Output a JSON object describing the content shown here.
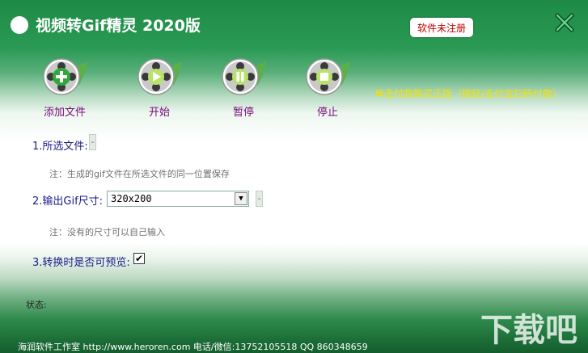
{
  "window": {
    "title": "视频转Gif精灵 2020版",
    "registration_badge": "软件未注册"
  },
  "toolbar": {
    "items": [
      {
        "label": "添加文件",
        "icon": "add-file-icon"
      },
      {
        "label": "开始",
        "icon": "play-icon"
      },
      {
        "label": "暂停",
        "icon": "pause-icon"
      },
      {
        "label": "停止",
        "icon": "stop-icon"
      }
    ]
  },
  "buy_link": "单击付款购买正版（微信/支付宝扫码付款）",
  "form": {
    "file_label": "1.所选文件:",
    "file_browse": "-",
    "file_note": "注：生成的gif文件在所选文件的同一位置保存",
    "size_label": "2.输出Gif尺寸:",
    "size_value": "320x200",
    "size_extra": "-",
    "size_note": "注：没有的尺寸可以自己输入",
    "preview_label": "3.转换时是否可预览:",
    "preview_checked": true,
    "status_label": "状态:"
  },
  "footer": "海润软件工作室 http://www.heroren.com  电话/微信:13752105518  QQ 860348659",
  "watermark": "下载吧",
  "colors": {
    "brand_green": "#1e8a45",
    "toolbar_label": "#7a0a7a",
    "buy_link": "#f5e400",
    "badge_text": "#c00000",
    "form_label": "#1a1a8a"
  }
}
